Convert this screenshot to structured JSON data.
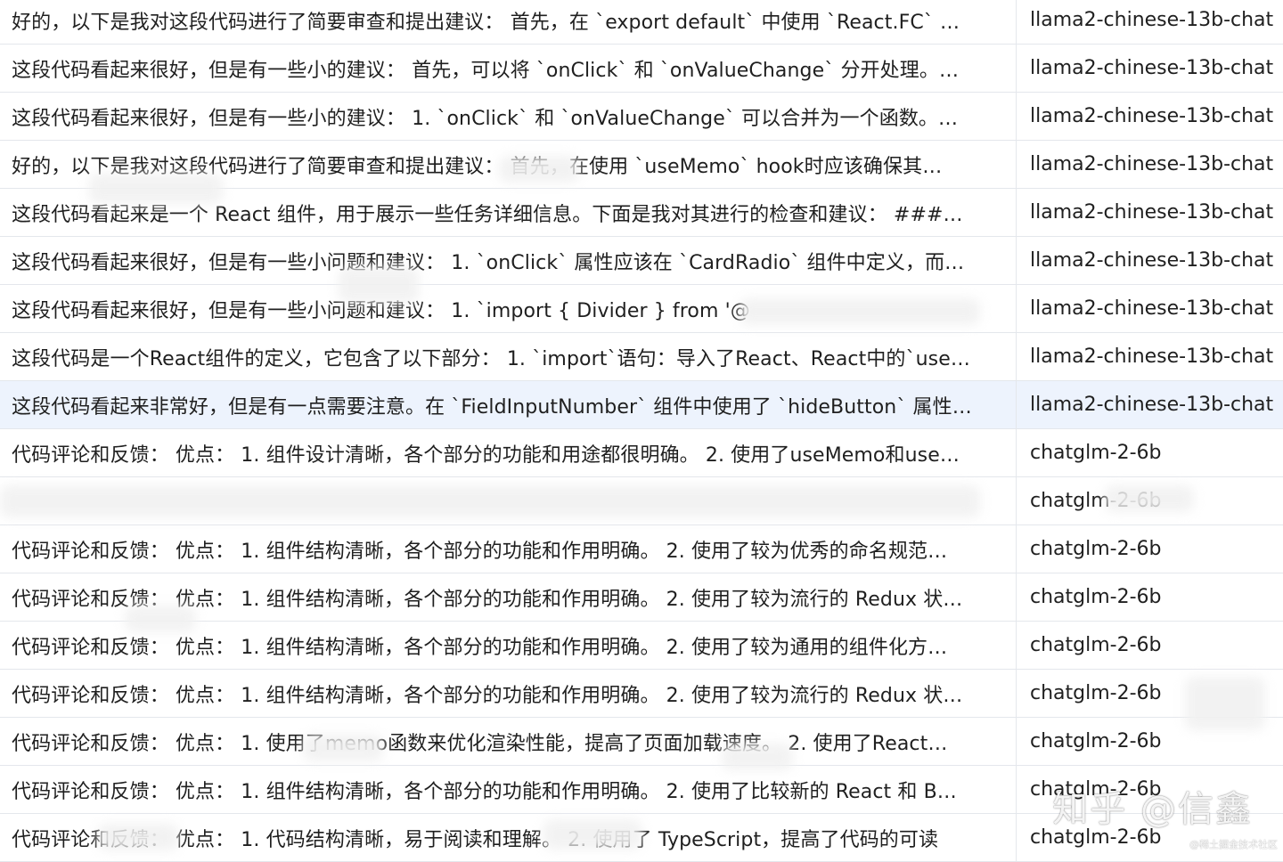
{
  "rows": [
    {
      "review": "好的，以下是我对这段代码进行了简要审查和提出建议： 首先，在 `export default` 中使用 `React.FC` …",
      "model": "llama2-chinese-13b-chat"
    },
    {
      "review": "这段代码看起来很好，但是有一些小的建议： 首先，可以将 `onClick` 和 `onValueChange` 分开处理。…",
      "model": "llama2-chinese-13b-chat"
    },
    {
      "review": "这段代码看起来很好，但是有一些小的建议： 1. `onClick` 和 `onValueChange` 可以合并为一个函数。…",
      "model": "llama2-chinese-13b-chat"
    },
    {
      "review": "好的，以下是我对这段代码进行了简要审查和提出建议： 首先，在使用 `useMemo` hook时应该确保其…",
      "model": "llama2-chinese-13b-chat"
    },
    {
      "review": "这段代码看起来是一个 React 组件，用于展示一些任务详细信息。下面是我对其进行的检查和建议： ###…",
      "model": "llama2-chinese-13b-chat"
    },
    {
      "review": "这段代码看起来很好，但是有一些小问题和建议： 1. `onClick` 属性应该在 `CardRadio` 组件中定义，而…",
      "model": "llama2-chinese-13b-chat"
    },
    {
      "review": "这段代码看起来很好，但是有一些小问题和建议：   1. `import { Divider } from '@",
      "model": "llama2-chinese-13b-chat"
    },
    {
      "review": "这段代码是一个React组件的定义，它包含了以下部分： 1. `import`语句：导入了React、React中的`use…",
      "model": "llama2-chinese-13b-chat"
    },
    {
      "review": "这段代码看起来非常好，但是有一点需要注意。在 `FieldInputNumber` 组件中使用了 `hideButton` 属性…",
      "model": "llama2-chinese-13b-chat"
    },
    {
      "review": "代码评论和反馈： 优点： 1. 组件设计清晰，各个部分的功能和用途都很明确。 2. 使用了useMemo和use…",
      "model": "chatglm-2-6b"
    },
    {
      "review": "",
      "model": "chatglm-2-6b"
    },
    {
      "review": "代码评论和反馈： 优点： 1. 组件结构清晰，各个部分的功能和作用明确。 2. 使用了较为优秀的命名规范…",
      "model": "chatglm-2-6b"
    },
    {
      "review": "代码评论和反馈： 优点： 1. 组件结构清晰，各个部分的功能和作用明确。 2. 使用了较为流行的 Redux 状…",
      "model": "chatglm-2-6b"
    },
    {
      "review": "代码评论和反馈： 优点： 1. 组件结构清晰，各个部分的功能和作用明确。 2. 使用了较为通用的组件化方…",
      "model": "chatglm-2-6b"
    },
    {
      "review": "代码评论和反馈： 优点： 1. 组件结构清晰，各个部分的功能和作用明确。 2. 使用了较为流行的 Redux 状…",
      "model": "chatglm-2-6b"
    },
    {
      "review": "代码评论和反馈： 优点： 1. 使用了memo函数来优化渲染性能，提高了页面加载速度。 2. 使用了React…",
      "model": "chatglm-2-6b"
    },
    {
      "review": "代码评论和反馈： 优点： 1. 组件结构清晰，各个部分的功能和作用明确。 2. 使用了比较新的 React 和 B…",
      "model": "chatglm-2-6b"
    },
    {
      "review": "代码评论和反馈： 优点： 1. 代码结构清晰，易于阅读和理解。 2. 使用了 TypeScript，提高了代码的可读",
      "model": "chatglm-2-6b"
    }
  ],
  "selected_row": 8,
  "watermark": {
    "main": "知乎 @信鑫",
    "small": "@稀土掘金技术社区"
  },
  "colors": {
    "selected_bg": "#edf3fd",
    "border": "#e4e7ec",
    "text": "#1f1f1f"
  }
}
